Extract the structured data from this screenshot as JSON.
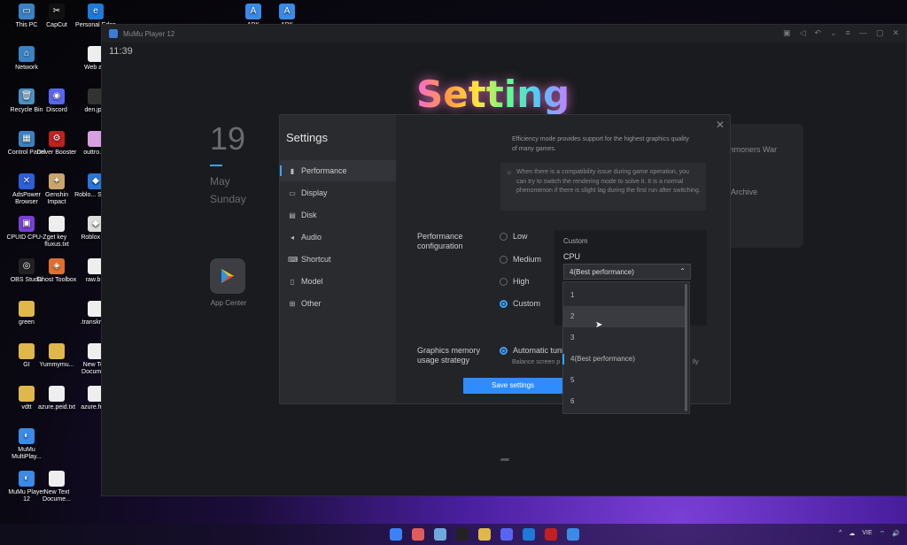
{
  "desktop": {
    "icons": [
      {
        "label": "This PC",
        "color": "#3b82c4",
        "glyph": "▭"
      },
      {
        "label": "CapCut",
        "color": "#111",
        "glyph": "✂"
      },
      {
        "label": "Personal Edge",
        "color": "#1e7ad8",
        "glyph": "e"
      },
      {
        "label": "Network",
        "color": "#3b82c4",
        "glyph": "⌂"
      },
      {
        "label": "Web a...",
        "color": "#eee",
        "glyph": ""
      },
      {
        "label": "Recycle Bin",
        "color": "#4a90c4",
        "glyph": "🗑"
      },
      {
        "label": "Discord",
        "color": "#5865f2",
        "glyph": "◉"
      },
      {
        "label": "den.jp...",
        "color": "#333",
        "glyph": ""
      },
      {
        "label": "Control Panel",
        "color": "#3b82c4",
        "glyph": "▦"
      },
      {
        "label": "Driver Booster",
        "color": "#c02020",
        "glyph": "⚙"
      },
      {
        "label": "outtro.r...",
        "color": "#d8a0e0",
        "glyph": ""
      },
      {
        "label": "AdsPower Browser",
        "color": "#2c5fd8",
        "glyph": "✕"
      },
      {
        "label": "Genshin Impact",
        "color": "#c9a66b",
        "glyph": "✦"
      },
      {
        "label": "Roblo... Studi...",
        "color": "#2a76d8",
        "glyph": "◆"
      },
      {
        "label": "CPUID CPU-Z",
        "color": "#7b3fd6",
        "glyph": "▣"
      },
      {
        "label": "get key fluxus.txt",
        "color": "#eee",
        "glyph": ""
      },
      {
        "label": "Roblox P...",
        "color": "#ddd",
        "glyph": "◆"
      },
      {
        "label": "OBS Studio",
        "color": "#222",
        "glyph": "◎"
      },
      {
        "label": "Ghost Toolbox",
        "color": "#e07030",
        "glyph": "◈"
      },
      {
        "label": "raw.b...",
        "color": "#eee",
        "glyph": ""
      },
      {
        "label": "green",
        "color": "#e0b84a",
        "glyph": ""
      },
      {
        "label": ".transkrip...",
        "color": "#eee",
        "glyph": ""
      },
      {
        "label": "GI",
        "color": "#e0b84a",
        "glyph": ""
      },
      {
        "label": "Yummymu...",
        "color": "#e0b84a",
        "glyph": ""
      },
      {
        "label": "New Text Docume...",
        "color": "#eee",
        "glyph": ""
      },
      {
        "label": "vdtt",
        "color": "#e0b84a",
        "glyph": ""
      },
      {
        "label": "azure.peid.txt",
        "color": "#eee",
        "glyph": ""
      },
      {
        "label": "azure.fre...",
        "color": "#eee",
        "glyph": ""
      },
      {
        "label": "MuMu MultiPlay...",
        "color": "#3a8be8",
        "glyph": "◐"
      },
      {
        "label": "MuMu Player 12",
        "color": "#3a8be8",
        "glyph": "◐"
      },
      {
        "label": "New Text Docume...",
        "color": "#eee",
        "glyph": ""
      },
      {
        "label": "APK",
        "color": "#3a8be8",
        "glyph": "A"
      },
      {
        "label": "APK",
        "color": "#3a8be8",
        "glyph": "A"
      }
    ]
  },
  "window": {
    "title": "MuMu Player 12",
    "controls": [
      "▣",
      "◁",
      "↶",
      "⌄",
      "≡",
      "—",
      "▢",
      "✕"
    ]
  },
  "screen": {
    "clock": "11:39",
    "date_day": "19",
    "date_month": "May",
    "date_weekday": "Sunday",
    "app_center_label": "App Center",
    "card_line1": "mmoners War",
    "card_line2": "Archive",
    "overlay_title": "Setting"
  },
  "settings": {
    "heading": "Settings",
    "close": "✕",
    "nav": [
      {
        "label": "Performance",
        "icon": "▮"
      },
      {
        "label": "Display",
        "icon": "▭"
      },
      {
        "label": "Disk",
        "icon": "▤"
      },
      {
        "label": "Audio",
        "icon": "◂"
      },
      {
        "label": "Shortcut",
        "icon": "⌨"
      },
      {
        "label": "Model",
        "icon": "▯"
      },
      {
        "label": "Other",
        "icon": "⊞"
      }
    ],
    "efficiency_text": "Efficiency mode provides support for the highest graphics quality of many games.",
    "tip_text": "When there is a compatibility issue during game operation, you can try to switch the rendering mode to solve it. It is a normal phenomenon if there is slight lag during the first run after switching.",
    "perf_label": "Performance configuration",
    "perf_options": [
      "Low",
      "Medium",
      "High",
      "Custom"
    ],
    "perf_selected": "Custom",
    "custom_title": "Custom",
    "cpu_label": "CPU",
    "cpu_value": "4(Best performance)",
    "gfx_label": "Graphics memory usage strategy",
    "gfx_option": "Automatic tuni",
    "gfx_sub": "Balance screen p",
    "gfx_sub2": "lly",
    "save_label": "Save settings"
  },
  "cpu_dropdown": {
    "options": [
      "1",
      "2",
      "3",
      "4(Best performance)",
      "5",
      "6"
    ],
    "hovered": "2",
    "current": "4(Best performance)"
  },
  "taskbar": {
    "tray": [
      "^",
      "☁",
      "VIE",
      "⌔",
      "🔊"
    ]
  }
}
